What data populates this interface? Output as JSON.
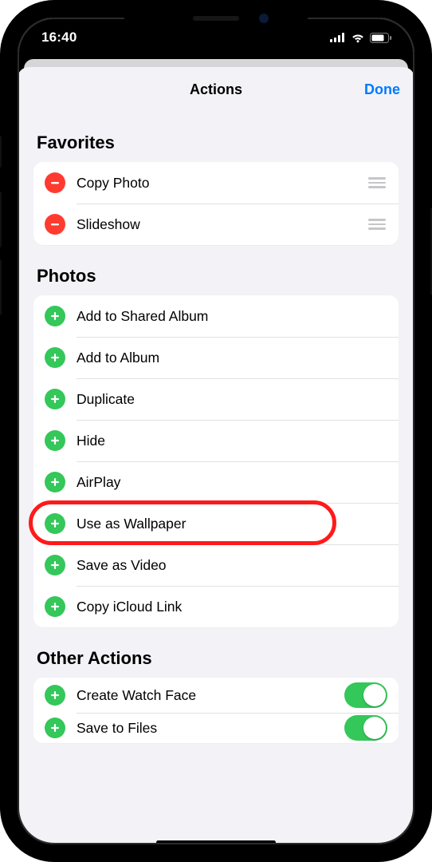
{
  "status": {
    "time": "16:40"
  },
  "nav": {
    "title": "Actions",
    "done": "Done"
  },
  "sections": {
    "favorites": {
      "title": "Favorites",
      "items": [
        {
          "label": "Copy Photo"
        },
        {
          "label": "Slideshow"
        }
      ]
    },
    "photos": {
      "title": "Photos",
      "items": [
        {
          "label": "Add to Shared Album"
        },
        {
          "label": "Add to Album"
        },
        {
          "label": "Duplicate"
        },
        {
          "label": "Hide"
        },
        {
          "label": "AirPlay"
        },
        {
          "label": "Use as Wallpaper"
        },
        {
          "label": "Save as Video"
        },
        {
          "label": "Copy iCloud Link"
        }
      ]
    },
    "other": {
      "title": "Other Actions",
      "items": [
        {
          "label": "Create Watch Face",
          "toggle": true
        },
        {
          "label": "Save to Files",
          "toggle": true
        }
      ]
    }
  }
}
